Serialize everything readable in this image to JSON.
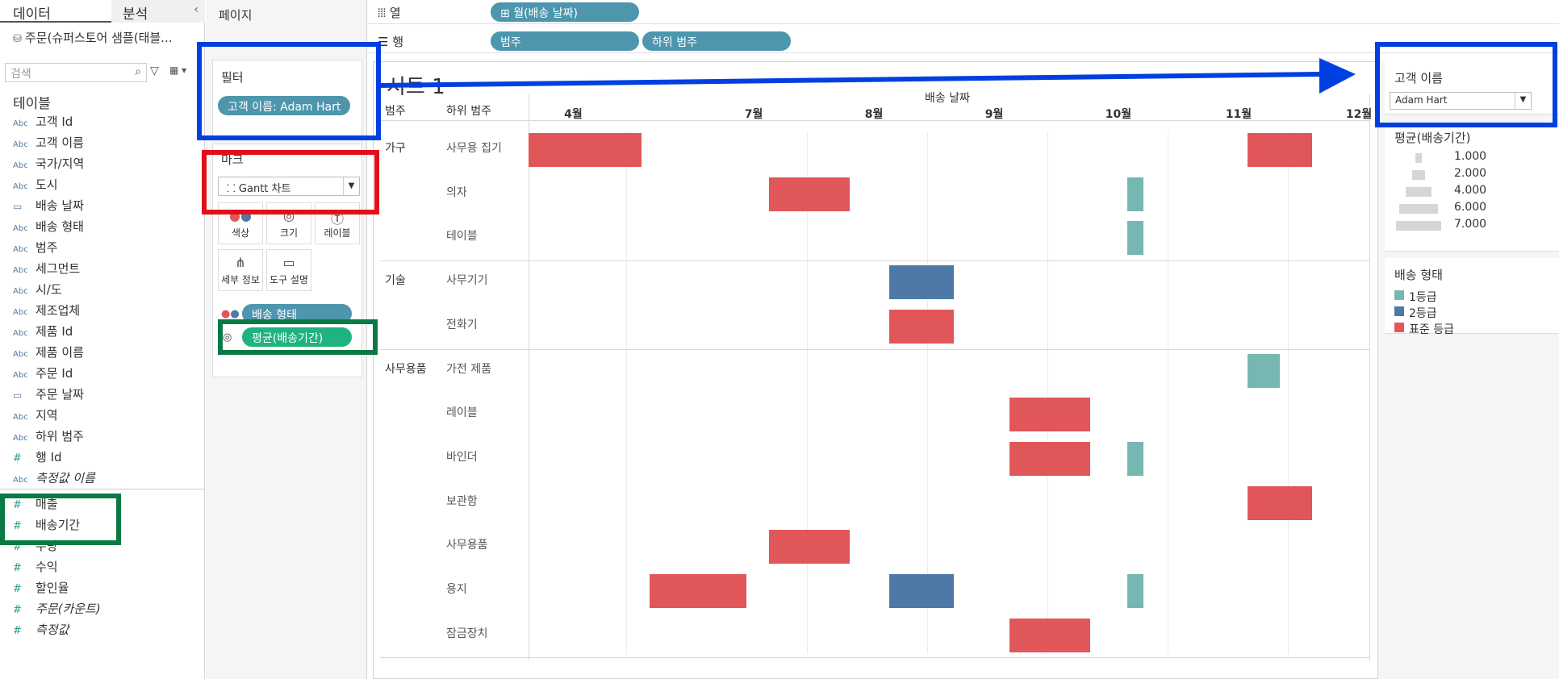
{
  "tabs": {
    "data": "데이터",
    "analysis": "분석"
  },
  "data_source": "주문(슈퍼스토어 샘플(태블...",
  "search_placeholder": "검색",
  "tables_heading": "테이블",
  "fields": [
    {
      "type": "Abc",
      "name": "고객 Id"
    },
    {
      "type": "Abc",
      "name": "고객 이름"
    },
    {
      "type": "Abc",
      "name": "국가/지역"
    },
    {
      "type": "Abc",
      "name": "도시"
    },
    {
      "type": "date",
      "name": "배송 날짜"
    },
    {
      "type": "Abc",
      "name": "배송 형태"
    },
    {
      "type": "Abc",
      "name": "범주"
    },
    {
      "type": "Abc",
      "name": "세그먼트"
    },
    {
      "type": "Abc",
      "name": "시/도"
    },
    {
      "type": "Abc",
      "name": "제조업체"
    },
    {
      "type": "Abc",
      "name": "제품 Id"
    },
    {
      "type": "Abc",
      "name": "제품 이름"
    },
    {
      "type": "Abc",
      "name": "주문 Id"
    },
    {
      "type": "date",
      "name": "주문 날짜"
    },
    {
      "type": "Abc",
      "name": "지역"
    },
    {
      "type": "Abc",
      "name": "하위 범주"
    },
    {
      "type": "#",
      "name": "행 Id"
    },
    {
      "type": "Abc",
      "name": "측정값 이름"
    },
    {
      "type": "#",
      "name": "매출"
    },
    {
      "type": "#",
      "name": "배송기간"
    },
    {
      "type": "#",
      "name": "수량"
    },
    {
      "type": "#",
      "name": "수익"
    },
    {
      "type": "#",
      "name": "할인율"
    },
    {
      "type": "#",
      "name": "주문(카운트)"
    },
    {
      "type": "#",
      "name": "측정값"
    }
  ],
  "pages_label": "페이지",
  "filters": {
    "title": "필터",
    "pill": "고객 이름: Adam Hart"
  },
  "marks": {
    "title": "마크",
    "type": "Gantt 차트",
    "buttons": [
      "색상",
      "크기",
      "레이블",
      "세부 정보",
      "도구 설명"
    ],
    "pill_color": "배송 형태",
    "pill_size": "평균(배송기간)"
  },
  "shelves": {
    "columns_label": "열",
    "columns_pill": "월(배송 날짜)",
    "rows_label": "행",
    "rows_pills": [
      "범주",
      "하위 범주"
    ]
  },
  "sheet_title": "시트 1",
  "chart_data": {
    "type": "gantt",
    "x_axis_title": "배송 날짜",
    "row_headers": [
      "범주",
      "하위 범주"
    ],
    "months": [
      "4월",
      "7월",
      "8월",
      "9월",
      "10월",
      "11월",
      "12월"
    ],
    "rows": [
      {
        "category": "가구",
        "subcategory": "사무용 집기"
      },
      {
        "category": "",
        "subcategory": "의자"
      },
      {
        "category": "",
        "subcategory": "테이블"
      },
      {
        "category": "기술",
        "subcategory": "사무기기"
      },
      {
        "category": "",
        "subcategory": "전화기"
      },
      {
        "category": "사무용품",
        "subcategory": "가전 제품"
      },
      {
        "category": "",
        "subcategory": "레이블"
      },
      {
        "category": "",
        "subcategory": "바인더"
      },
      {
        "category": "",
        "subcategory": "보관함"
      },
      {
        "category": "",
        "subcategory": "사무용품"
      },
      {
        "category": "",
        "subcategory": "용지"
      },
      {
        "category": "",
        "subcategory": "잠금장치"
      }
    ],
    "marks": [
      {
        "row": 0,
        "month": 0,
        "duration": 7.0,
        "ship_mode": "표준 등급"
      },
      {
        "row": 0,
        "month": 6,
        "duration": 4.0,
        "ship_mode": "표준 등급"
      },
      {
        "row": 1,
        "month": 2,
        "duration": 5.0,
        "ship_mode": "표준 등급"
      },
      {
        "row": 1,
        "month": 5,
        "duration": 1.0,
        "ship_mode": "1등급"
      },
      {
        "row": 2,
        "month": 5,
        "duration": 1.0,
        "ship_mode": "1등급"
      },
      {
        "row": 3,
        "month": 3,
        "duration": 4.0,
        "ship_mode": "2등급"
      },
      {
        "row": 4,
        "month": 3,
        "duration": 4.0,
        "ship_mode": "표준 등급"
      },
      {
        "row": 5,
        "month": 6,
        "duration": 2.0,
        "ship_mode": "1등급"
      },
      {
        "row": 6,
        "month": 4,
        "duration": 5.0,
        "ship_mode": "표준 등급"
      },
      {
        "row": 7,
        "month": 4,
        "duration": 5.0,
        "ship_mode": "표준 등급"
      },
      {
        "row": 7,
        "month": 5,
        "duration": 1.0,
        "ship_mode": "1등급"
      },
      {
        "row": 8,
        "month": 6,
        "duration": 4.0,
        "ship_mode": "표준 등급"
      },
      {
        "row": 9,
        "month": 2,
        "duration": 5.0,
        "ship_mode": "표준 등급"
      },
      {
        "row": 10,
        "month": 1,
        "duration": 6.0,
        "ship_mode": "표준 등급"
      },
      {
        "row": 10,
        "month": 3,
        "duration": 4.0,
        "ship_mode": "2등급"
      },
      {
        "row": 10,
        "month": 5,
        "duration": 1.0,
        "ship_mode": "1등급"
      },
      {
        "row": 11,
        "month": 4,
        "duration": 5.0,
        "ship_mode": "표준 등급"
      }
    ]
  },
  "legend": {
    "customer_filter_title": "고객 이름",
    "customer_filter_value": "Adam Hart",
    "size_title": "평균(배송기간)",
    "size_values": [
      "1.000",
      "2.000",
      "4.000",
      "6.000",
      "7.000"
    ],
    "color_title": "배송 형태",
    "color_items": [
      {
        "label": "1등급",
        "color": "#76b7b2"
      },
      {
        "label": "2등급",
        "color": "#4e79a7"
      },
      {
        "label": "표준 등급",
        "color": "#e15759"
      }
    ]
  },
  "colors": {
    "pill_blue": "#4d96ad",
    "pill_green": "#1fb37f",
    "annotation_blue": "#0040e0",
    "annotation_red": "#e0101a",
    "annotation_green": "#0a7a45"
  }
}
